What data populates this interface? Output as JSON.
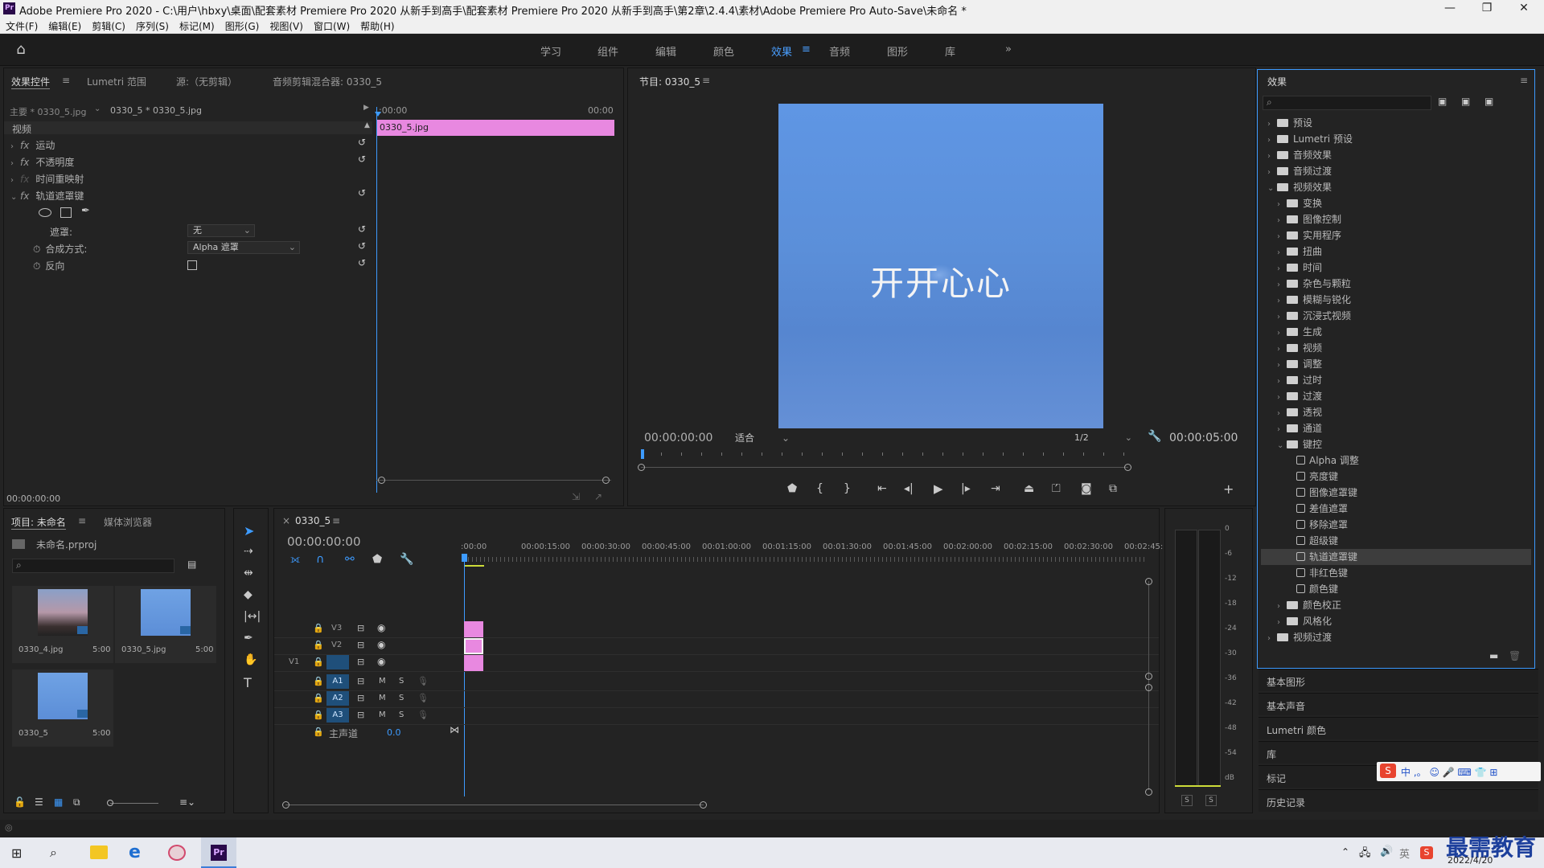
{
  "titlebar": {
    "logo": "Pr",
    "title": "Adobe Premiere Pro 2020 - C:\\用户\\hbxy\\桌面\\配套素材 Premiere Pro 2020 从新手到高手\\配套素材 Premiere Pro 2020 从新手到高手\\第2章\\2.4.4\\素材\\Adobe Premiere Pro Auto-Save\\未命名 *",
    "minimize": "—",
    "maximize": "❐",
    "close": "✕"
  },
  "menubar": [
    "文件(F)",
    "编辑(E)",
    "剪辑(C)",
    "序列(S)",
    "标记(M)",
    "图形(G)",
    "视图(V)",
    "窗口(W)",
    "帮助(H)"
  ],
  "workspaces": [
    "学习",
    "组件",
    "编辑",
    "颜色",
    "效果",
    "音频",
    "图形",
    "库"
  ],
  "workspace_active": "效果",
  "workspace_more": "»",
  "effect_controls": {
    "tabs": [
      "效果控件",
      "Lumetri 范围",
      "源:（无剪辑）",
      "音频剪辑混合器: 0330_5"
    ],
    "master_clip": "主要 * 0330_5.jpg",
    "sequence_clip": "0330_5 * 0330_5.jpg",
    "time_start": ":00:00",
    "time_end": "00:00",
    "clip_bar_label": "0330_5.jpg",
    "section": "视频",
    "properties": [
      "运动",
      "不透明度",
      "时间重映射",
      "轨道遮罩键"
    ],
    "matte_label": "遮罩:",
    "matte_value": "无",
    "composite_label": "合成方式:",
    "composite_value": "Alpha 遮罩",
    "reverse_label": "反向",
    "current_time": "00:00:00:00"
  },
  "program_monitor": {
    "title": "节目: 0330_5",
    "caption_text": "开开心心",
    "timecode": "00:00:00:00",
    "fit_label": "适合",
    "resolution": "1/2",
    "duration": "00:00:05:00"
  },
  "effects_panel": {
    "title": "效果",
    "tree": [
      {
        "label": "预设",
        "level": 0,
        "type": "folder-star"
      },
      {
        "label": "Lumetri 预设",
        "level": 0,
        "type": "folder-star"
      },
      {
        "label": "音频效果",
        "level": 0,
        "type": "folder"
      },
      {
        "label": "音频过渡",
        "level": 0,
        "type": "folder"
      },
      {
        "label": "视频效果",
        "level": 0,
        "type": "folder",
        "open": true
      },
      {
        "label": "变换",
        "level": 1,
        "type": "folder"
      },
      {
        "label": "图像控制",
        "level": 1,
        "type": "folder"
      },
      {
        "label": "实用程序",
        "level": 1,
        "type": "folder"
      },
      {
        "label": "扭曲",
        "level": 1,
        "type": "folder"
      },
      {
        "label": "时间",
        "level": 1,
        "type": "folder"
      },
      {
        "label": "杂色与颗粒",
        "level": 1,
        "type": "folder"
      },
      {
        "label": "模糊与锐化",
        "level": 1,
        "type": "folder"
      },
      {
        "label": "沉浸式视频",
        "level": 1,
        "type": "folder"
      },
      {
        "label": "生成",
        "level": 1,
        "type": "folder"
      },
      {
        "label": "视频",
        "level": 1,
        "type": "folder"
      },
      {
        "label": "调整",
        "level": 1,
        "type": "folder"
      },
      {
        "label": "过时",
        "level": 1,
        "type": "folder"
      },
      {
        "label": "过渡",
        "level": 1,
        "type": "folder"
      },
      {
        "label": "透视",
        "level": 1,
        "type": "folder"
      },
      {
        "label": "通道",
        "level": 1,
        "type": "folder"
      },
      {
        "label": "键控",
        "level": 1,
        "type": "folder",
        "open": true
      },
      {
        "label": "Alpha 调整",
        "level": 2,
        "type": "effect"
      },
      {
        "label": "亮度键",
        "level": 2,
        "type": "effect"
      },
      {
        "label": "图像遮罩键",
        "level": 2,
        "type": "effect"
      },
      {
        "label": "差值遮罩",
        "level": 2,
        "type": "effect"
      },
      {
        "label": "移除遮罩",
        "level": 2,
        "type": "effect"
      },
      {
        "label": "超级键",
        "level": 2,
        "type": "effect"
      },
      {
        "label": "轨道遮罩键",
        "level": 2,
        "type": "effect",
        "selected": true
      },
      {
        "label": "非红色键",
        "level": 2,
        "type": "effect"
      },
      {
        "label": "颜色键",
        "level": 2,
        "type": "effect"
      },
      {
        "label": "颜色校正",
        "level": 1,
        "type": "folder"
      },
      {
        "label": "风格化",
        "level": 1,
        "type": "folder"
      },
      {
        "label": "视频过渡",
        "level": 0,
        "type": "folder"
      }
    ]
  },
  "side_panels": [
    "基本图形",
    "基本声音",
    "Lumetri 颜色",
    "库",
    "标记",
    "历史记录"
  ],
  "project_panel": {
    "tabs": [
      "项目: 未命名",
      "媒体浏览器"
    ],
    "project_file": "未命名.prproj",
    "items": [
      {
        "name": "0330_4.jpg",
        "duration": "5:00"
      },
      {
        "name": "0330_5.jpg",
        "duration": "5:00"
      },
      {
        "name": "0330_5",
        "duration": "5:00"
      }
    ]
  },
  "timeline": {
    "title": "0330_5",
    "timecode": "00:00:00:00",
    "ruler": [
      ":00:00",
      "00:00:15:00",
      "00:00:30:00",
      "00:00:45:00",
      "00:01:00:00",
      "00:01:15:00",
      "00:01:30:00",
      "00:01:45:00",
      "00:02:00:00",
      "00:02:15:00",
      "00:02:30:00",
      "00:02:45:"
    ],
    "video_tracks": [
      "V3",
      "V2",
      "V1"
    ],
    "source_patch": "V1",
    "audio_tracks": [
      "A1",
      "A2",
      "A3"
    ],
    "master_label": "主声道",
    "master_value": "0.0",
    "mute": "M",
    "solo": "S"
  },
  "audio_meter": {
    "scale": [
      "0",
      "-6",
      "-12",
      "-18",
      "-24",
      "-30",
      "-36",
      "-42",
      "-48",
      "-54",
      "dB"
    ],
    "solo_left": "S",
    "solo_right": "S"
  },
  "taskbar": {
    "date": "2022/4/20",
    "watermark": "最需教育"
  },
  "colors": {
    "accent_blue": "#3d9bff",
    "clip_pink": "#e888e0",
    "panel_bg": "#232323",
    "sky_blue": "#5b8fd9"
  }
}
